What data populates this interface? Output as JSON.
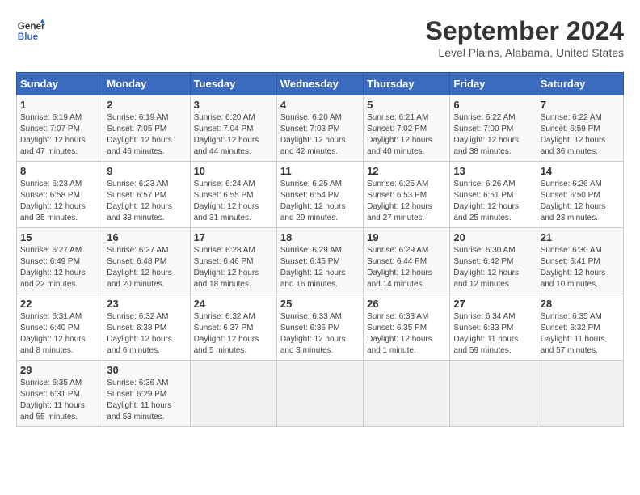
{
  "logo": {
    "line1": "General",
    "line2": "Blue"
  },
  "title": "September 2024",
  "location": "Level Plains, Alabama, United States",
  "days_header": [
    "Sunday",
    "Monday",
    "Tuesday",
    "Wednesday",
    "Thursday",
    "Friday",
    "Saturday"
  ],
  "weeks": [
    [
      {
        "day": "1",
        "info": "Sunrise: 6:19 AM\nSunset: 7:07 PM\nDaylight: 12 hours\nand 47 minutes."
      },
      {
        "day": "2",
        "info": "Sunrise: 6:19 AM\nSunset: 7:05 PM\nDaylight: 12 hours\nand 46 minutes."
      },
      {
        "day": "3",
        "info": "Sunrise: 6:20 AM\nSunset: 7:04 PM\nDaylight: 12 hours\nand 44 minutes."
      },
      {
        "day": "4",
        "info": "Sunrise: 6:20 AM\nSunset: 7:03 PM\nDaylight: 12 hours\nand 42 minutes."
      },
      {
        "day": "5",
        "info": "Sunrise: 6:21 AM\nSunset: 7:02 PM\nDaylight: 12 hours\nand 40 minutes."
      },
      {
        "day": "6",
        "info": "Sunrise: 6:22 AM\nSunset: 7:00 PM\nDaylight: 12 hours\nand 38 minutes."
      },
      {
        "day": "7",
        "info": "Sunrise: 6:22 AM\nSunset: 6:59 PM\nDaylight: 12 hours\nand 36 minutes."
      }
    ],
    [
      {
        "day": "8",
        "info": "Sunrise: 6:23 AM\nSunset: 6:58 PM\nDaylight: 12 hours\nand 35 minutes."
      },
      {
        "day": "9",
        "info": "Sunrise: 6:23 AM\nSunset: 6:57 PM\nDaylight: 12 hours\nand 33 minutes."
      },
      {
        "day": "10",
        "info": "Sunrise: 6:24 AM\nSunset: 6:55 PM\nDaylight: 12 hours\nand 31 minutes."
      },
      {
        "day": "11",
        "info": "Sunrise: 6:25 AM\nSunset: 6:54 PM\nDaylight: 12 hours\nand 29 minutes."
      },
      {
        "day": "12",
        "info": "Sunrise: 6:25 AM\nSunset: 6:53 PM\nDaylight: 12 hours\nand 27 minutes."
      },
      {
        "day": "13",
        "info": "Sunrise: 6:26 AM\nSunset: 6:51 PM\nDaylight: 12 hours\nand 25 minutes."
      },
      {
        "day": "14",
        "info": "Sunrise: 6:26 AM\nSunset: 6:50 PM\nDaylight: 12 hours\nand 23 minutes."
      }
    ],
    [
      {
        "day": "15",
        "info": "Sunrise: 6:27 AM\nSunset: 6:49 PM\nDaylight: 12 hours\nand 22 minutes."
      },
      {
        "day": "16",
        "info": "Sunrise: 6:27 AM\nSunset: 6:48 PM\nDaylight: 12 hours\nand 20 minutes."
      },
      {
        "day": "17",
        "info": "Sunrise: 6:28 AM\nSunset: 6:46 PM\nDaylight: 12 hours\nand 18 minutes."
      },
      {
        "day": "18",
        "info": "Sunrise: 6:29 AM\nSunset: 6:45 PM\nDaylight: 12 hours\nand 16 minutes."
      },
      {
        "day": "19",
        "info": "Sunrise: 6:29 AM\nSunset: 6:44 PM\nDaylight: 12 hours\nand 14 minutes."
      },
      {
        "day": "20",
        "info": "Sunrise: 6:30 AM\nSunset: 6:42 PM\nDaylight: 12 hours\nand 12 minutes."
      },
      {
        "day": "21",
        "info": "Sunrise: 6:30 AM\nSunset: 6:41 PM\nDaylight: 12 hours\nand 10 minutes."
      }
    ],
    [
      {
        "day": "22",
        "info": "Sunrise: 6:31 AM\nSunset: 6:40 PM\nDaylight: 12 hours\nand 8 minutes."
      },
      {
        "day": "23",
        "info": "Sunrise: 6:32 AM\nSunset: 6:38 PM\nDaylight: 12 hours\nand 6 minutes."
      },
      {
        "day": "24",
        "info": "Sunrise: 6:32 AM\nSunset: 6:37 PM\nDaylight: 12 hours\nand 5 minutes."
      },
      {
        "day": "25",
        "info": "Sunrise: 6:33 AM\nSunset: 6:36 PM\nDaylight: 12 hours\nand 3 minutes."
      },
      {
        "day": "26",
        "info": "Sunrise: 6:33 AM\nSunset: 6:35 PM\nDaylight: 12 hours\nand 1 minute."
      },
      {
        "day": "27",
        "info": "Sunrise: 6:34 AM\nSunset: 6:33 PM\nDaylight: 11 hours\nand 59 minutes."
      },
      {
        "day": "28",
        "info": "Sunrise: 6:35 AM\nSunset: 6:32 PM\nDaylight: 11 hours\nand 57 minutes."
      }
    ],
    [
      {
        "day": "29",
        "info": "Sunrise: 6:35 AM\nSunset: 6:31 PM\nDaylight: 11 hours\nand 55 minutes."
      },
      {
        "day": "30",
        "info": "Sunrise: 6:36 AM\nSunset: 6:29 PM\nDaylight: 11 hours\nand 53 minutes."
      },
      {
        "day": "",
        "info": ""
      },
      {
        "day": "",
        "info": ""
      },
      {
        "day": "",
        "info": ""
      },
      {
        "day": "",
        "info": ""
      },
      {
        "day": "",
        "info": ""
      }
    ]
  ]
}
